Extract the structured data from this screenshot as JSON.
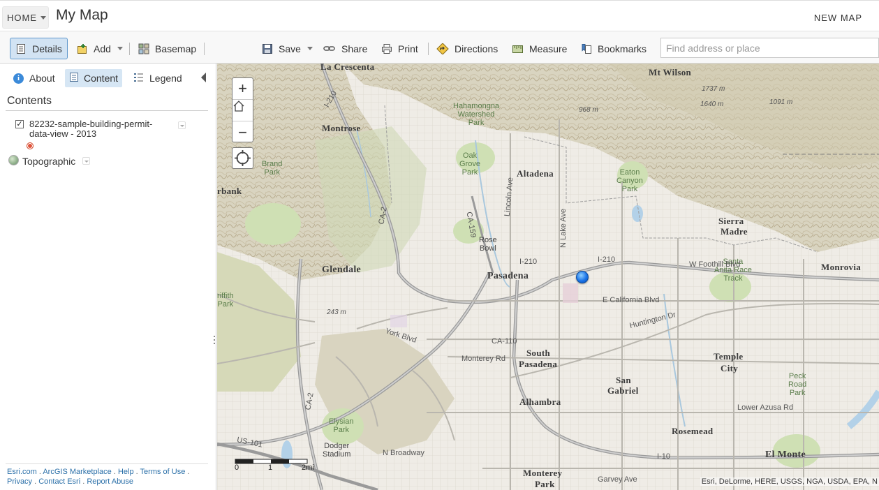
{
  "header": {
    "home_label": "HOME",
    "title": "My Map",
    "new_map_label": "NEW MAP"
  },
  "toolbar": {
    "details": "Details",
    "add": "Add",
    "basemap": "Basemap",
    "save": "Save",
    "share": "Share",
    "print": "Print",
    "directions": "Directions",
    "measure": "Measure",
    "bookmarks": "Bookmarks",
    "search_placeholder": "Find address or place"
  },
  "panel": {
    "tabs": {
      "about": "About",
      "content": "Content",
      "legend": "Legend"
    },
    "contents_heading": "Contents",
    "layers": [
      {
        "label": "82232-sample-building-permit-data-view - 2013",
        "checked": true
      }
    ],
    "basemap_label": "Topographic",
    "footer": {
      "esri": "Esri.com",
      "marketplace": "ArcGIS Marketplace",
      "help": "Help",
      "terms": "Terms of Use",
      "privacy": "Privacy",
      "contact": "Contact Esri",
      "report": "Report Abuse"
    }
  },
  "map": {
    "labels": {
      "la_crescenta": "La Crescenta",
      "mt_wilson": "Mt Wilson",
      "montrose": "Montrose",
      "altadena": "Altadena",
      "sierra": "Sierra",
      "madre": "Madre",
      "glendale": "Glendale",
      "pasadena": "Pasadena",
      "monrovia": "Monrovia",
      "burbank": "rbank",
      "south": "South",
      "south_pasadena": "Pasadena",
      "temple": "Temple",
      "city": "City",
      "san": "San",
      "gabriel": "Gabriel",
      "alhambra": "Alhambra",
      "rosemead": "Rosemead",
      "el_monte": "El Monte",
      "monterey": "Monterey",
      "park": "Park",
      "santa_anita": "Santa\nAnita Race\nTrack",
      "hahamongna": "Hahamongna\nWatershed\nPark",
      "oak_grove": "Oak\nGrove\nPark",
      "eaton_canyon": "Eaton\nCanyon\nPark",
      "brand_park": "Brand\nPark",
      "rose_bowl": "Rose\nBowl",
      "griffith": "riffith\nPark",
      "elysian": "Elysian\nPark",
      "dodger": "Dodger\nStadium",
      "peck_road": "Peck\nRoad\nPark",
      "i210_a": "I-210",
      "i210_b": "I-210",
      "i210_c": "I-210",
      "i10": "I-10",
      "ca110": "CA-110",
      "ca2": "CA-2",
      "ca2b": "CA-2",
      "us101": "US-101",
      "ca159": "CA-159",
      "w_foothill": "W Foothill Blvd",
      "e_california": "E California Blvd",
      "huntington": "Huntington Dr",
      "york": "York Blvd",
      "monterey_rd": "Monterey Rd",
      "garvey": "Garvey Ave",
      "lower_azusa": "Lower Azusa Rd",
      "broadway": "N Broadway",
      "lincoln": "Lincoln Ave",
      "n_lake": "N Lake Ave",
      "elev_968": "968 m",
      "elev_1737": "1737 m",
      "elev_1640": "1640 m",
      "elev_1091": "1091 m",
      "elev_243": "243 m"
    },
    "scale": {
      "zero": "0",
      "one": "1",
      "two": "2mi"
    },
    "attribution": "Esri, DeLorme, HERE, USGS, NGA, USDA, EPA, N"
  },
  "colors": {
    "accent": "#5f98cc",
    "marker": "#1a73e8",
    "layer_dot": "#e0523a"
  }
}
